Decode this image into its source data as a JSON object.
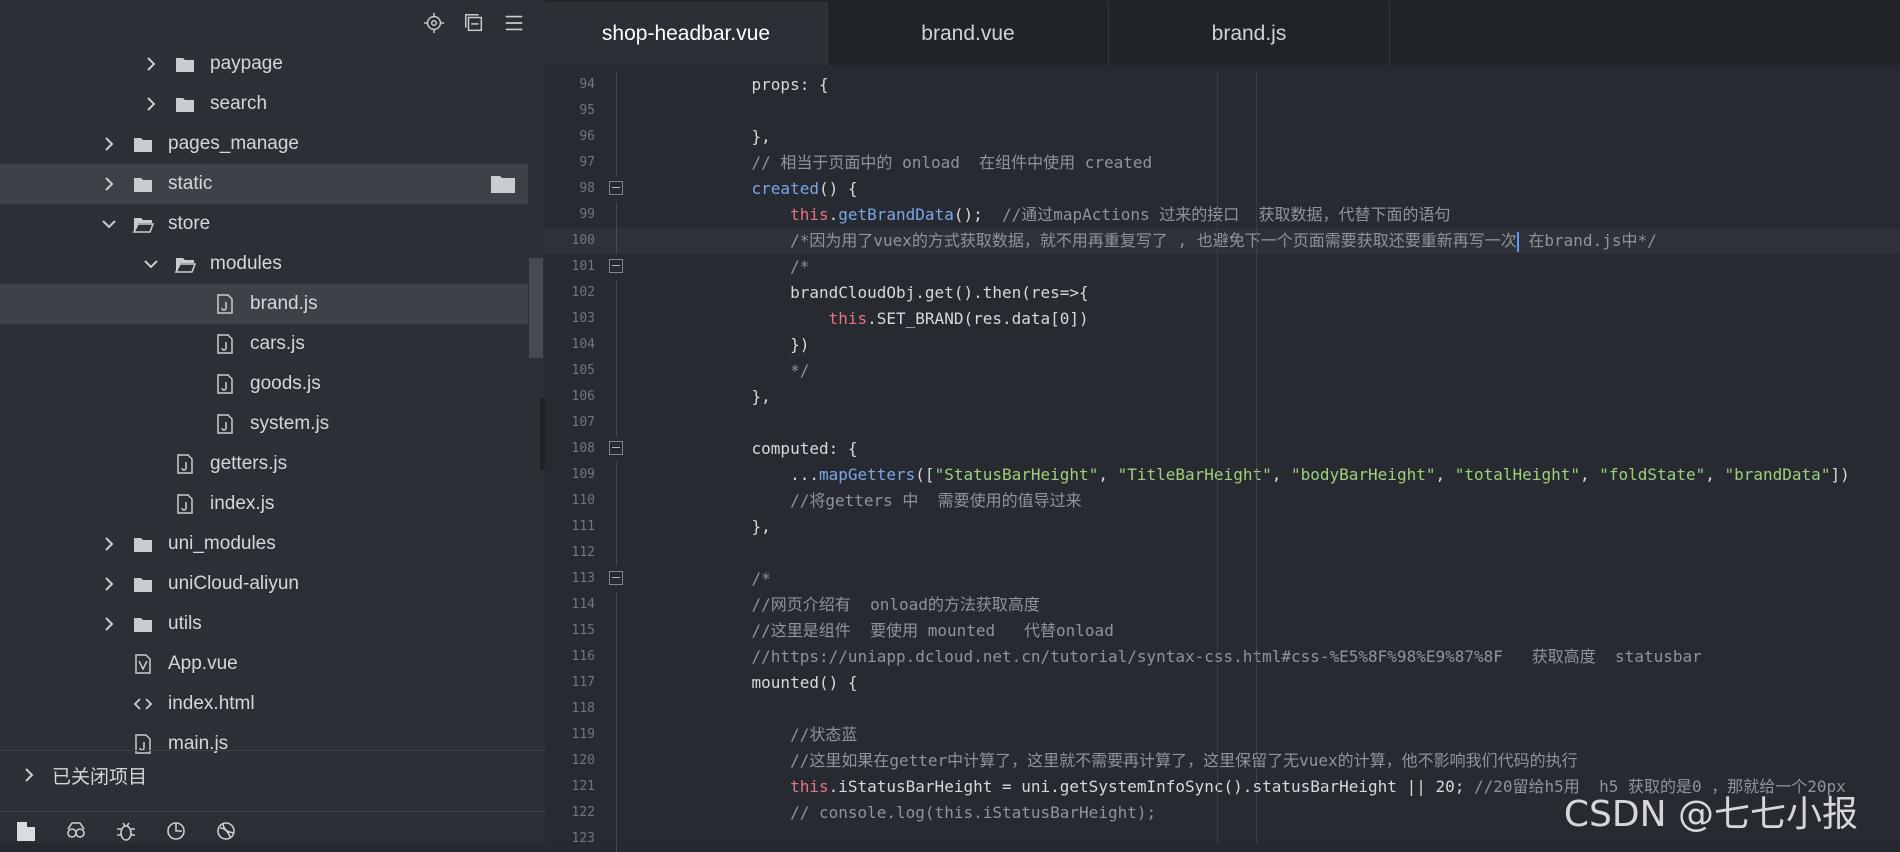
{
  "sidebar": {
    "tree": [
      {
        "label": "paypage",
        "type": "folder",
        "expanded": false,
        "level": 3
      },
      {
        "label": "search",
        "type": "folder",
        "expanded": false,
        "level": 3
      },
      {
        "label": "pages_manage",
        "type": "folder",
        "expanded": false,
        "level": 2
      },
      {
        "label": "static",
        "type": "folder",
        "expanded": false,
        "level": 2,
        "selected": true
      },
      {
        "label": "store",
        "type": "folder",
        "expanded": true,
        "level": 2
      },
      {
        "label": "modules",
        "type": "folder",
        "expanded": true,
        "level": 3
      },
      {
        "label": "brand.js",
        "type": "js",
        "level": 4,
        "selected": true
      },
      {
        "label": "cars.js",
        "type": "js",
        "level": 4
      },
      {
        "label": "goods.js",
        "type": "js",
        "level": 4
      },
      {
        "label": "system.js",
        "type": "js",
        "level": 4
      },
      {
        "label": "getters.js",
        "type": "js",
        "level": 3
      },
      {
        "label": "index.js",
        "type": "js",
        "level": 3
      },
      {
        "label": "uni_modules",
        "type": "folder",
        "expanded": false,
        "level": 2
      },
      {
        "label": "uniCloud-aliyun",
        "type": "folder",
        "expanded": false,
        "level": 2
      },
      {
        "label": "utils",
        "type": "folder",
        "expanded": false,
        "level": 2
      },
      {
        "label": "App.vue",
        "type": "vue",
        "level": 2
      },
      {
        "label": "index.html",
        "type": "html",
        "level": 2
      },
      {
        "label": "main.js",
        "type": "js",
        "level": 2
      }
    ],
    "closed_projects_label": "已关闭项目"
  },
  "tabs": [
    {
      "label": "shop-headbar.vue",
      "active": true
    },
    {
      "label": "brand.vue",
      "active": false
    },
    {
      "label": "brand.js",
      "active": false
    }
  ],
  "code_lines": [
    {
      "num": "94",
      "text": "    props: {"
    },
    {
      "num": "95",
      "text": ""
    },
    {
      "num": "96",
      "text": "    },"
    },
    {
      "num": "97",
      "text": "    // 相当于页面中的 onload  在组件中使用 created"
    },
    {
      "num": "98",
      "text": "    created() {",
      "fold": true
    },
    {
      "num": "99",
      "text": "        this.getBrandData();  //通过mapActions 过来的接口  获取数据，代替下面的语句"
    },
    {
      "num": "100",
      "text": "        /*因为用了vuex的方式获取数据，就不用再重复写了 , 也避免下一个页面需要获取还要重新再写一次 在brand.js中*/",
      "current": true
    },
    {
      "num": "101",
      "text": "        /*",
      "fold": true
    },
    {
      "num": "102",
      "text": "        brandCloudObj.get().then(res=>{"
    },
    {
      "num": "103",
      "text": "            this.SET_BRAND(res.data[0])"
    },
    {
      "num": "104",
      "text": "        })"
    },
    {
      "num": "105",
      "text": "        */"
    },
    {
      "num": "106",
      "text": "    },"
    },
    {
      "num": "107",
      "text": ""
    },
    {
      "num": "108",
      "text": "    computed: {",
      "fold": true
    },
    {
      "num": "109",
      "text": "        ...mapGetters([\"StatusBarHeight\", \"TitleBarHeight\", \"bodyBarHeight\", \"totalHeight\", \"foldState\", \"brandData\"])"
    },
    {
      "num": "110",
      "text": "        //将getters 中  需要使用的值导过来"
    },
    {
      "num": "111",
      "text": "    },"
    },
    {
      "num": "112",
      "text": ""
    },
    {
      "num": "113",
      "text": "    /*",
      "fold": true
    },
    {
      "num": "114",
      "text": "    //网页介绍有  onload的方法获取高度"
    },
    {
      "num": "115",
      "text": "    //这里是组件  要使用 mounted   代替onload"
    },
    {
      "num": "116",
      "text": "    //https://uniapp.dcloud.net.cn/tutorial/syntax-css.html#css-%E5%8F%98%E9%87%8F   获取高度  statusbar"
    },
    {
      "num": "117",
      "text": "    mounted() {"
    },
    {
      "num": "118",
      "text": ""
    },
    {
      "num": "119",
      "text": "        //状态蓝"
    },
    {
      "num": "120",
      "text": "        //这里如果在getter中计算了，这里就不需要再计算了，这里保留了无vuex的计算，他不影响我们代码的执行"
    },
    {
      "num": "121",
      "text": "        this.iStatusBarHeight = uni.getSystemInfoSync().statusBarHeight || 20; //20留给h5用  h5 获取的是0 ，那就给一个20px"
    },
    {
      "num": "122",
      "text": "        // console.log(this.iStatusBarHeight);"
    },
    {
      "num": "123",
      "text": ""
    }
  ],
  "watermark": "CSDN @七七小报",
  "colors": {
    "sidebar_bg": "#2b3036",
    "editor_bg": "#272b31",
    "keyword_this": "#e5757e",
    "function": "#7aa6e8",
    "string": "#9ed07a",
    "comment": "#8e949c"
  }
}
